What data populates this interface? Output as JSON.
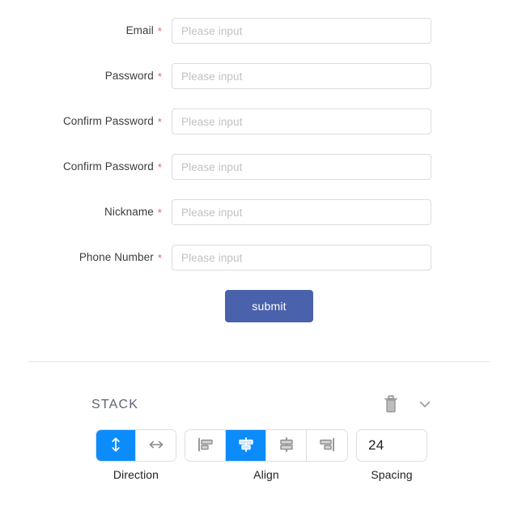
{
  "form": {
    "fields": [
      {
        "label": "Email",
        "required": true,
        "value": "",
        "placeholder": "Please input"
      },
      {
        "label": "Password",
        "required": true,
        "value": "",
        "placeholder": "Please input"
      },
      {
        "label": "Confirm Password",
        "required": true,
        "value": "",
        "placeholder": "Please input"
      },
      {
        "label": "Confirm Password",
        "required": true,
        "value": "",
        "placeholder": "Please input"
      },
      {
        "label": "Nickname",
        "required": true,
        "value": "",
        "placeholder": "Please input"
      },
      {
        "label": "Phone Number",
        "required": true,
        "value": "",
        "placeholder": "Please input"
      }
    ],
    "required_marker": "*",
    "submit_label": "submit",
    "submit_color": "#4a62ab"
  },
  "stack_panel": {
    "title": "STACK",
    "delete_icon": "trash-icon",
    "collapse_icon": "chevron-down-icon",
    "accent_color": "#0c8cfb",
    "direction": {
      "label": "Direction",
      "options": [
        {
          "name": "vertical",
          "icon": "arrows-vertical-icon",
          "selected": true
        },
        {
          "name": "horizontal",
          "icon": "arrows-horizontal-icon",
          "selected": false
        }
      ]
    },
    "align": {
      "label": "Align",
      "options": [
        {
          "name": "align-start",
          "icon": "align-left-icon",
          "selected": false
        },
        {
          "name": "align-center",
          "icon": "align-center-icon",
          "selected": true
        },
        {
          "name": "align-middle",
          "icon": "align-middle-icon",
          "selected": false
        },
        {
          "name": "align-end",
          "icon": "align-right-icon",
          "selected": false
        }
      ]
    },
    "spacing": {
      "label": "Spacing",
      "value": "24"
    }
  }
}
